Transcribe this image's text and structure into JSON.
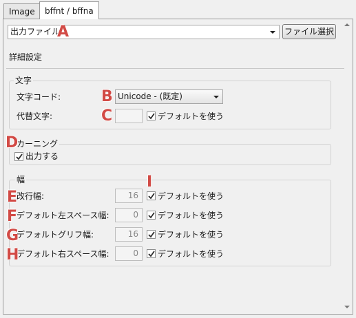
{
  "tabs": [
    {
      "label": "Image"
    },
    {
      "label": "bffnt / bffna"
    }
  ],
  "output_file": {
    "label": "出力ファイル",
    "value": "",
    "select_button": "ファイル選択"
  },
  "details_header": "詳細設定",
  "char_group": {
    "title": "文字",
    "code_label": "文字コード:",
    "code_value": "Unicode - (既定)",
    "alt_char_label": "代替文字:",
    "alt_char_value": "",
    "alt_char_default": "デフォルトを使う"
  },
  "kerning_group": {
    "title": "カーニング",
    "output_label": "出力する"
  },
  "width_group": {
    "title": "幅",
    "rows": [
      {
        "label": "改行幅:",
        "value": "16",
        "default_label": "デフォルトを使う"
      },
      {
        "label": "デフォルト左スペース幅:",
        "value": "0",
        "default_label": "デフォルトを使う"
      },
      {
        "label": "デフォルトグリフ幅:",
        "value": "16",
        "default_label": "デフォルトを使う"
      },
      {
        "label": "デフォルト右スペース幅:",
        "value": "0",
        "default_label": "デフォルトを使う"
      }
    ]
  },
  "markers": {
    "a": "A",
    "b": "B",
    "c": "C",
    "d": "D",
    "e": "E",
    "f": "F",
    "g": "G",
    "h": "H",
    "i": "I"
  },
  "colors": {
    "marker": "#d24a45",
    "panel_bg": "#f0f0f0"
  }
}
